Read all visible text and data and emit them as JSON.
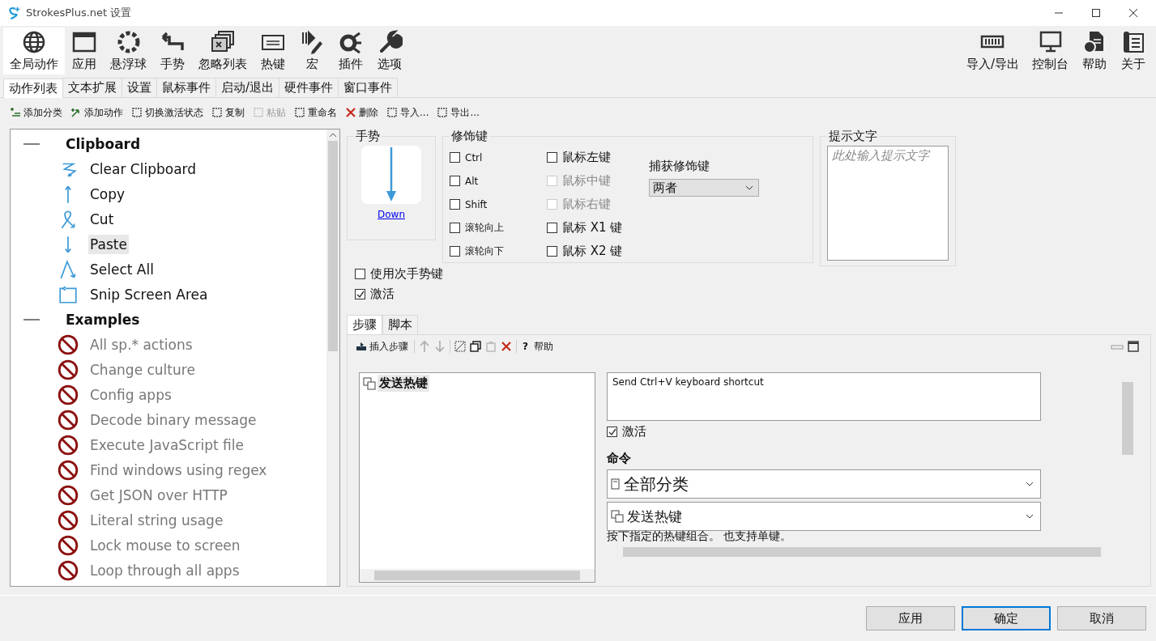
{
  "window": {
    "title": "StrokesPlus.net 设置"
  },
  "main_toolbar": {
    "left": [
      {
        "label": "全局动作",
        "selected": true
      },
      {
        "label": "应用",
        "selected": false
      },
      {
        "label": "悬浮球",
        "selected": false
      },
      {
        "label": "手势",
        "selected": false
      },
      {
        "label": "忽略列表",
        "selected": false
      },
      {
        "label": "热键",
        "selected": false
      },
      {
        "label": "宏",
        "selected": false
      },
      {
        "label": "插件",
        "selected": false
      },
      {
        "label": "选项",
        "selected": false
      }
    ],
    "right": [
      {
        "label": "导入/导出",
        "selected": false
      },
      {
        "label": "控制台",
        "selected": false
      },
      {
        "label": "帮助",
        "selected": false
      },
      {
        "label": "关于",
        "selected": false
      }
    ]
  },
  "tabs": [
    {
      "label": "动作列表",
      "selected": true
    },
    {
      "label": "文本扩展",
      "selected": false
    },
    {
      "label": "设置",
      "selected": false
    },
    {
      "label": "鼠标事件",
      "selected": false
    },
    {
      "label": "启动/退出",
      "selected": false
    },
    {
      "label": "硬件事件",
      "selected": false
    },
    {
      "label": "窗口事件",
      "selected": false
    }
  ],
  "action_toolbar": [
    {
      "label": "添加分类",
      "disabled": false
    },
    {
      "label": "添加动作",
      "disabled": false
    },
    {
      "label": "切换激活状态",
      "disabled": false
    },
    {
      "label": "复制",
      "disabled": false
    },
    {
      "label": "粘贴",
      "disabled": true
    },
    {
      "label": "重命名",
      "disabled": false
    },
    {
      "label": "删除",
      "disabled": false
    },
    {
      "label": "导入...",
      "disabled": false
    },
    {
      "label": "导出...",
      "disabled": false
    }
  ],
  "tree": [
    {
      "label": "Clipboard",
      "expanded": true,
      "children": [
        {
          "label": "Clear Clipboard",
          "enabled": true,
          "selected": false
        },
        {
          "label": "Copy",
          "enabled": true,
          "selected": false
        },
        {
          "label": "Cut",
          "enabled": true,
          "selected": false
        },
        {
          "label": "Paste",
          "enabled": true,
          "selected": true
        },
        {
          "label": "Select All",
          "enabled": true,
          "selected": false
        },
        {
          "label": "Snip Screen Area",
          "enabled": true,
          "selected": false
        }
      ]
    },
    {
      "label": "Examples",
      "expanded": true,
      "children": [
        {
          "label": "All sp.* actions",
          "enabled": false,
          "selected": false
        },
        {
          "label": "Change culture",
          "enabled": false,
          "selected": false
        },
        {
          "label": "Config apps",
          "enabled": false,
          "selected": false
        },
        {
          "label": "Decode binary message",
          "enabled": false,
          "selected": false
        },
        {
          "label": "Execute JavaScript file",
          "enabled": false,
          "selected": false
        },
        {
          "label": "Find windows using regex",
          "enabled": false,
          "selected": false
        },
        {
          "label": "Get JSON over HTTP",
          "enabled": false,
          "selected": false
        },
        {
          "label": "Literal string usage",
          "enabled": false,
          "selected": false
        },
        {
          "label": "Lock mouse to screen",
          "enabled": false,
          "selected": false
        },
        {
          "label": "Loop through all apps",
          "enabled": false,
          "selected": false
        }
      ]
    }
  ],
  "gesture": {
    "title": "手势",
    "name": "Down"
  },
  "modifiers": {
    "title": "修饰键",
    "keys": [
      {
        "label": "Ctrl",
        "checked": false,
        "disabled": false
      },
      {
        "label": "Alt",
        "checked": false,
        "disabled": false
      },
      {
        "label": "Shift",
        "checked": false,
        "disabled": false
      },
      {
        "label": "滚轮向上",
        "checked": false,
        "disabled": false
      },
      {
        "label": "滚轮向下",
        "checked": false,
        "disabled": false
      },
      {
        "label": "鼠标左键",
        "checked": false,
        "disabled": false
      },
      {
        "label": "鼠标中键",
        "checked": false,
        "disabled": true
      },
      {
        "label": "鼠标右键",
        "checked": false,
        "disabled": true
      },
      {
        "label": "鼠标 X1 键",
        "checked": false,
        "disabled": false
      },
      {
        "label": "鼠标 X2 键",
        "checked": false,
        "disabled": false
      }
    ],
    "capture": {
      "label": "捕获修饰键",
      "value": "两者"
    }
  },
  "hint": {
    "title": "提示文字",
    "placeholder": "此处输入提示文字"
  },
  "options": [
    {
      "label": "使用次手势键",
      "checked": false
    },
    {
      "label": "激活",
      "checked": true
    }
  ],
  "sub_tabs": [
    {
      "label": "步骤",
      "selected": true
    },
    {
      "label": "脚本",
      "selected": false
    }
  ],
  "step_toolbar": {
    "insert": "插入步骤",
    "help_mark": "?",
    "help": "帮助",
    "paste_disabled": true
  },
  "steps": [
    {
      "label": "发送热键",
      "selected": true
    }
  ],
  "step_detail": {
    "description": "Send Ctrl+V keyboard shortcut",
    "enabled_label": "激活",
    "enabled": true,
    "command_label": "命令",
    "category": "全部分类",
    "command": "发送热键",
    "help_text": "按下指定的热键组合。 也支持单键。"
  },
  "buttons": [
    {
      "label": "应用",
      "default": false
    },
    {
      "label": "确定",
      "default": true
    },
    {
      "label": "取消",
      "default": false
    }
  ]
}
